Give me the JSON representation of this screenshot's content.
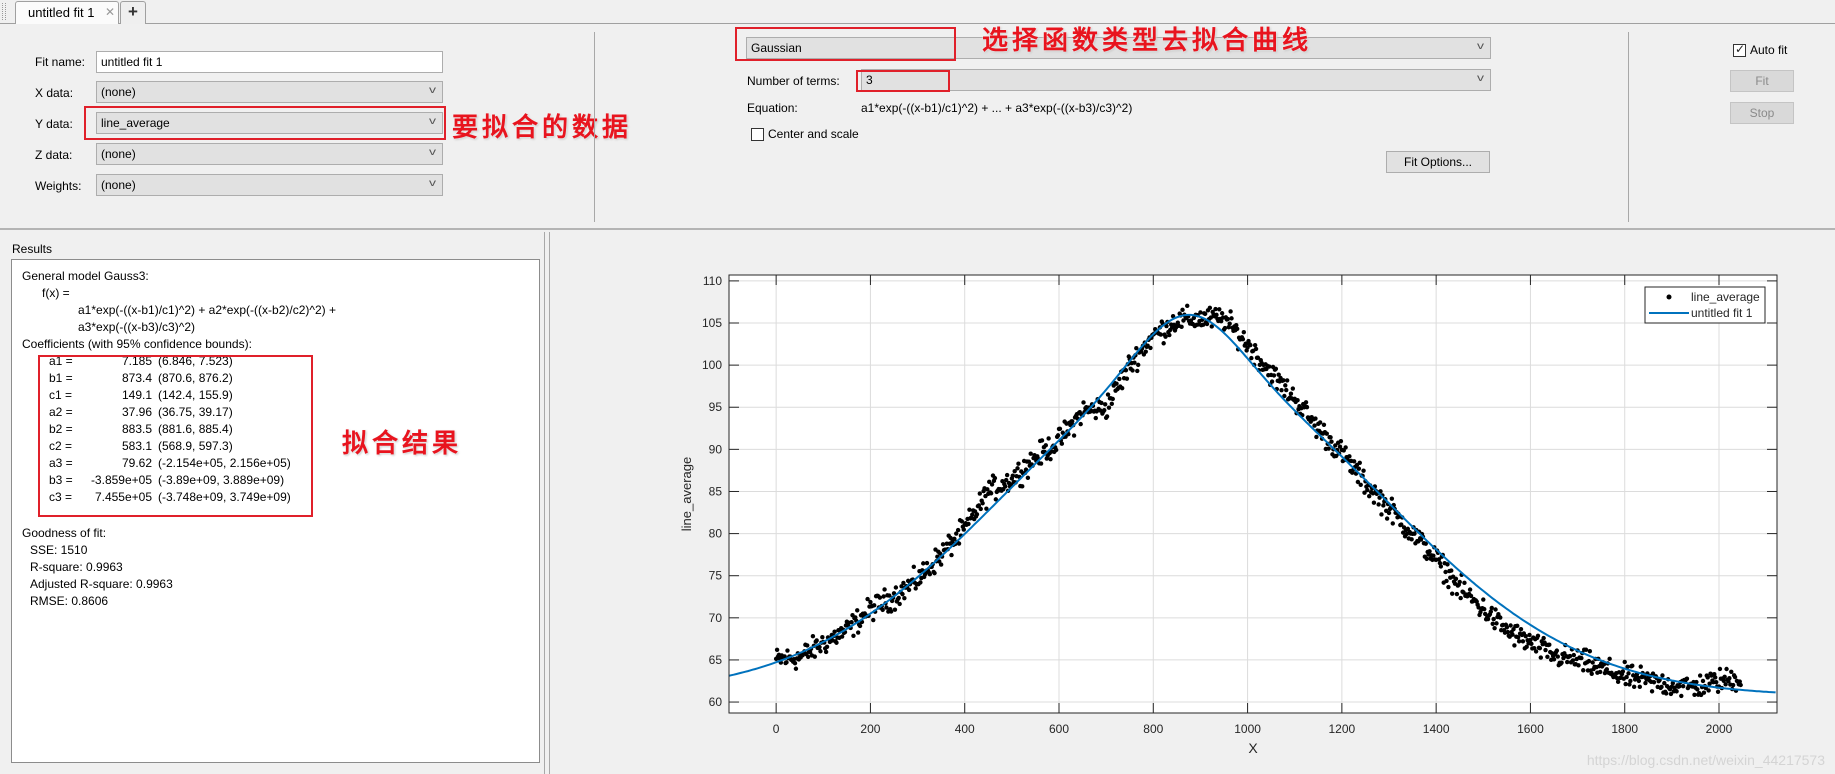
{
  "tabs": [
    {
      "label": "untitled fit 1",
      "active": true,
      "close_icon": "close-icon"
    },
    {
      "label": "+",
      "icon": "plus-icon"
    }
  ],
  "data_selection": {
    "fit_name_label": "Fit name:",
    "fit_name_value": "untitled fit 1",
    "x_data_label": "X data:",
    "x_data_value": "(none)",
    "y_data_label": "Y data:",
    "y_data_value": "line_average",
    "z_data_label": "Z data:",
    "z_data_value": "(none)",
    "weights_label": "Weights:",
    "weights_value": "(none)"
  },
  "fit_type": {
    "type_value": "Gaussian",
    "num_terms_label": "Number of terms:",
    "num_terms_value": "3",
    "equation_label": "Equation:",
    "equation_value": "a1*exp(-((x-b1)/c1)^2) + ... + a3*exp(-((x-b3)/c3)^2)",
    "center_scale_label": "Center and scale",
    "center_scale_checked": false,
    "fit_options_label": "Fit Options..."
  },
  "fit_controls": {
    "auto_fit_label": "Auto fit",
    "auto_fit_checked": true,
    "fit_label": "Fit",
    "stop_label": "Stop"
  },
  "annotations": {
    "y_data_note": "要拟合的数据",
    "fit_type_note": "选择函数类型去拟合曲线",
    "results_note": "拟合结果",
    "color": "#e0202a"
  },
  "results": {
    "title": "Results",
    "model": "General model Gauss3:",
    "fx": "f(x) =",
    "expr_line1": "a1*exp(-((x-b1)/c1)^2) + a2*exp(-((x-b2)/c2)^2) +",
    "expr_line2": "a3*exp(-((x-b3)/c3)^2)",
    "coeff_header": "Coefficients (with 95% confidence bounds):",
    "coefficients": [
      {
        "name": "a1 =",
        "value": "7.185",
        "bounds": "(6.846, 7.523)"
      },
      {
        "name": "b1 =",
        "value": "873.4",
        "bounds": "(870.6, 876.2)"
      },
      {
        "name": "c1 =",
        "value": "149.1",
        "bounds": "(142.4, 155.9)"
      },
      {
        "name": "a2 =",
        "value": "37.96",
        "bounds": "(36.75, 39.17)"
      },
      {
        "name": "b2 =",
        "value": "883.5",
        "bounds": "(881.6, 885.4)"
      },
      {
        "name": "c2 =",
        "value": "583.1",
        "bounds": "(568.9, 597.3)"
      },
      {
        "name": "a3 =",
        "value": "79.62",
        "bounds": "(-2.154e+05, 2.156e+05)"
      },
      {
        "name": "b3 =",
        "value": "-3.859e+05",
        "bounds": "(-3.89e+09, 3.889e+09)"
      },
      {
        "name": "c3 =",
        "value": "7.455e+05",
        "bounds": "(-3.748e+09, 3.749e+09)"
      }
    ],
    "gof_header": "Goodness of fit:",
    "gof": [
      "SSE: 1510",
      "R-square: 0.9963",
      "Adjusted R-square: 0.9963",
      "RMSE: 0.8606"
    ]
  },
  "watermark": "https://blog.csdn.net/weixin_44217573",
  "chart_data": {
    "type": "scatter",
    "title": "",
    "xlabel": "X",
    "ylabel": "line_average",
    "xlim": [
      -100,
      2123
    ],
    "ylim": [
      58.7,
      110.7
    ],
    "xticks": [
      0,
      200,
      400,
      600,
      800,
      1000,
      1200,
      1400,
      1600,
      1800,
      2000
    ],
    "yticks": [
      60,
      65,
      70,
      75,
      80,
      85,
      90,
      95,
      100,
      105,
      110
    ],
    "grid": true,
    "legend": {
      "position": "top-right",
      "entries": [
        "line_average",
        "untitled fit 1"
      ]
    },
    "colors": {
      "points": "#000000",
      "fit": "#0072bd"
    },
    "series": [
      {
        "name": "line_average",
        "kind": "points",
        "x_range": [
          0,
          2047
        ],
        "approx_points": [
          [
            0,
            65.0
          ],
          [
            50,
            65.3
          ],
          [
            100,
            67.0
          ],
          [
            150,
            68.5
          ],
          [
            200,
            71.0
          ],
          [
            250,
            72.5
          ],
          [
            300,
            74.5
          ],
          [
            350,
            77.5
          ],
          [
            400,
            80.5
          ],
          [
            450,
            85.0
          ],
          [
            500,
            86.5
          ],
          [
            550,
            89.0
          ],
          [
            600,
            91.0
          ],
          [
            650,
            94.5
          ],
          [
            700,
            95.0
          ],
          [
            750,
            100.0
          ],
          [
            800,
            103.5
          ],
          [
            850,
            105.3
          ],
          [
            900,
            105.5
          ],
          [
            950,
            105.5
          ],
          [
            1000,
            102.5
          ],
          [
            1050,
            99.0
          ],
          [
            1100,
            96.0
          ],
          [
            1150,
            92.5
          ],
          [
            1200,
            89.5
          ],
          [
            1250,
            86.0
          ],
          [
            1300,
            83.0
          ],
          [
            1350,
            80.0
          ],
          [
            1400,
            77.0
          ],
          [
            1450,
            73.5
          ],
          [
            1500,
            71.0
          ],
          [
            1550,
            68.5
          ],
          [
            1600,
            67.0
          ],
          [
            1650,
            65.5
          ],
          [
            1700,
            65.0
          ],
          [
            1750,
            64.0
          ],
          [
            1800,
            63.0
          ],
          [
            1850,
            62.5
          ],
          [
            1900,
            62.0
          ],
          [
            1950,
            61.8
          ],
          [
            2000,
            62.5
          ],
          [
            2047,
            62.8
          ]
        ]
      },
      {
        "name": "untitled fit 1",
        "kind": "line",
        "model": "gauss3",
        "coefficients": {
          "a1": 7.185,
          "b1": 873.4,
          "c1": 149.1,
          "a2": 37.96,
          "b2": 883.5,
          "c2": 583.1,
          "a3": 79.62,
          "b3": -385900,
          "c3": 745500
        }
      }
    ]
  }
}
